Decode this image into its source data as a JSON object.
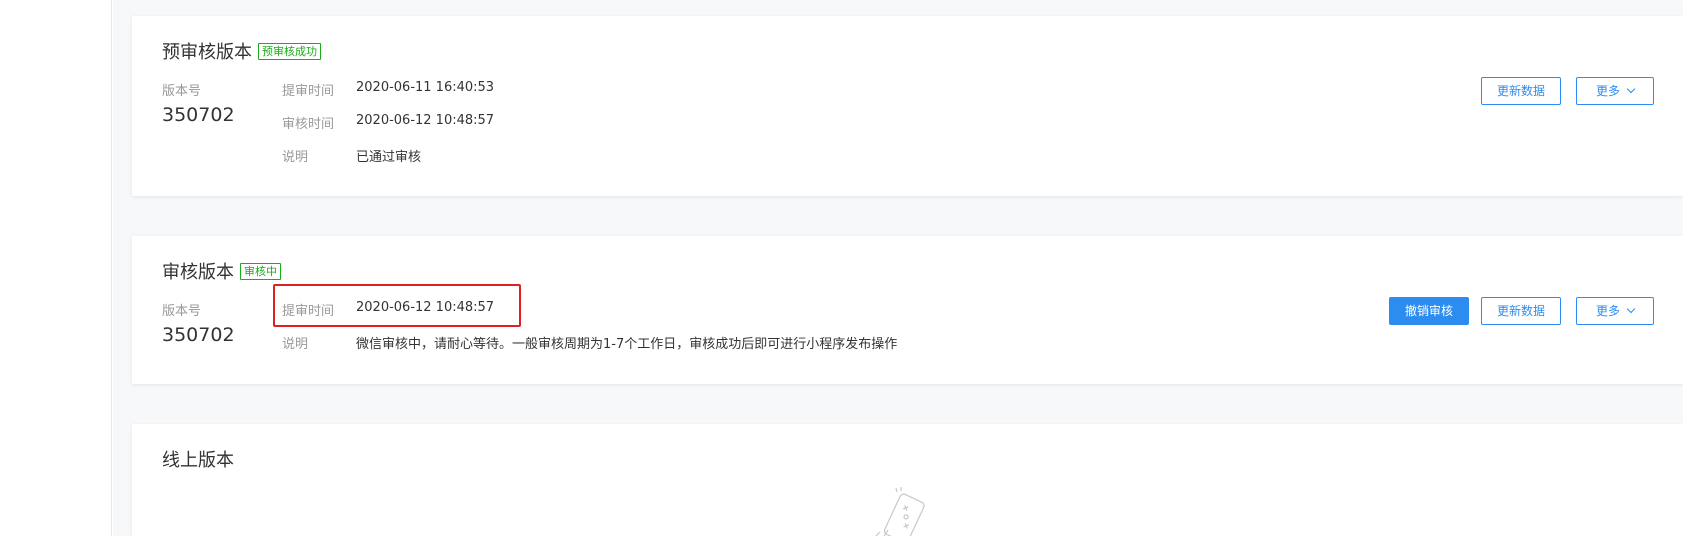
{
  "review_pending_card": {
    "title": "预审核版本",
    "status_tag": "预审核成功",
    "version_label": "版本号",
    "version_number": "350702",
    "rows": [
      {
        "label": "提审时间",
        "value": "2020-06-11 16:40:53"
      },
      {
        "label": "审核时间",
        "value": "2020-06-12 10:48:57"
      },
      {
        "label": "说明",
        "value": "已通过审核"
      }
    ],
    "buttons": {
      "refresh": "更新数据",
      "more": "更多"
    }
  },
  "review_card": {
    "title": "审核版本",
    "status_tag": "审核中",
    "version_label": "版本号",
    "version_number": "350702",
    "rows": [
      {
        "label": "提审时间",
        "value": "2020-06-12 10:48:57"
      },
      {
        "label": "说明",
        "value": "微信审核中，请耐心等待。一般审核周期为1-7个工作日，审核成功后即可进行小程序发布操作"
      }
    ],
    "buttons": {
      "withdraw": "撤销审核",
      "refresh": "更新数据",
      "more": "更多"
    }
  },
  "online_card": {
    "title": "线上版本"
  },
  "colors": {
    "accent": "#2d8cf0",
    "success": "#1aad19",
    "highlight": "#e02020"
  }
}
